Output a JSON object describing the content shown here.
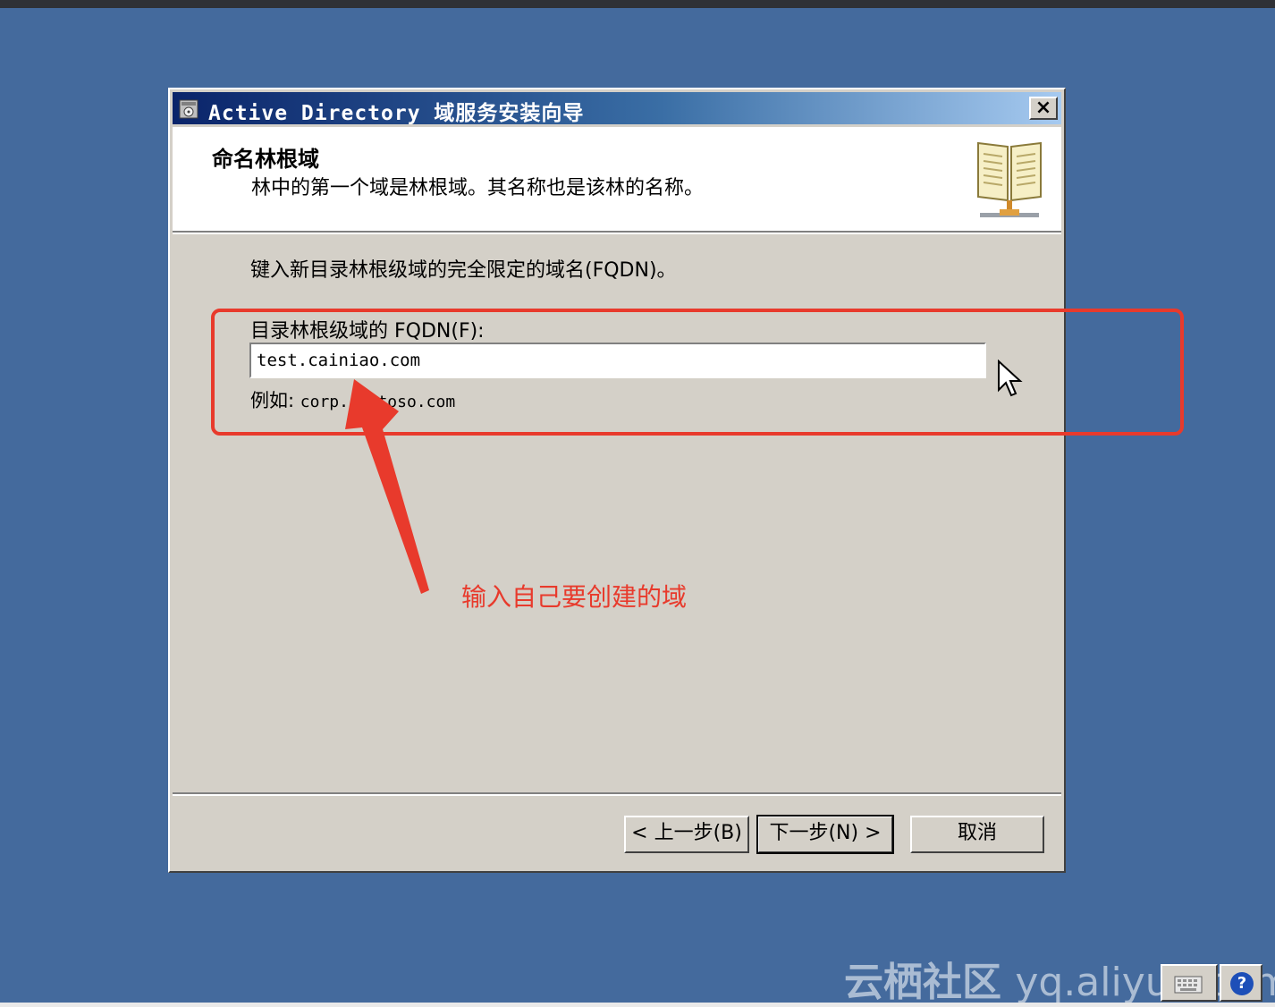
{
  "window": {
    "title": "Active Directory 域服务安装向导",
    "close_label": "×"
  },
  "header": {
    "title": "命名林根域",
    "subtitle": "林中的第一个域是林根域。其名称也是该林的名称。",
    "icon": "book-icon"
  },
  "content": {
    "instruction": "键入新目录林根级域的完全限定的域名(FQDN)。",
    "field_label": "目录林根级域的 FQDN(F):",
    "field_value": "test.cainiao.com",
    "example_label": "例如:",
    "example_value": "corp.contoso.com"
  },
  "buttons": {
    "back": "< 上一步(B)",
    "next": "下一步(N) >",
    "cancel": "取消"
  },
  "annotation": {
    "text": "输入自己要创建的域",
    "color": "#e83a2c"
  },
  "watermark": {
    "brand": "云栖社区",
    "domain": "yq.aliyun.com"
  },
  "tray": {
    "keyboard_icon": "keyboard-icon",
    "help_icon": "help-icon",
    "help_glyph": "?"
  },
  "colors": {
    "desktop": "#446a9d",
    "dialog": "#d4d0c8",
    "titlebar_start": "#0a246a",
    "titlebar_end": "#a6caf0",
    "annotation": "#e83a2c"
  }
}
